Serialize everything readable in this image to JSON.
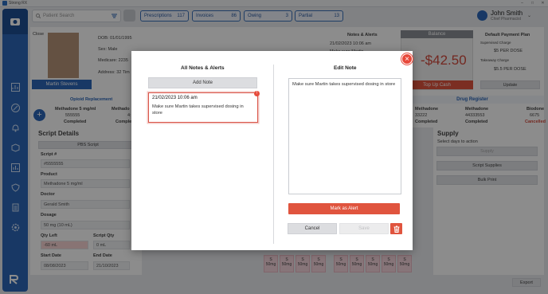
{
  "app": {
    "title": "Strong RX",
    "window_controls": [
      "–",
      "□",
      "✕"
    ]
  },
  "search": {
    "placeholder": "Patient Search"
  },
  "pills": [
    {
      "label": "Prescriptions",
      "count": "117"
    },
    {
      "label": "Invoices",
      "count": "86"
    },
    {
      "label": "Owing",
      "count": "3"
    },
    {
      "label": "Partial",
      "count": "13"
    }
  ],
  "user": {
    "name": "John Smith",
    "role": "Chief Pharmacist"
  },
  "patient": {
    "close_label": "Close",
    "name": "Martin Stevens",
    "dob": "DOB: 01/01/1995",
    "sex": "Sex: Male",
    "medicare": "Medicare: 2235",
    "address": "Address: 32 Tim"
  },
  "notes_panel": {
    "title": "Notes & Alerts",
    "date": "21/02/2023 10:06 am",
    "text": "Make sure Martin"
  },
  "balance": {
    "title": "Balance",
    "amount": "-$42.50",
    "topup": "Top Up Cash"
  },
  "payment": {
    "title": "Default Payment Plan",
    "supervised_label": "Supervised Charge",
    "supervised_value": "$5 PER DOSE",
    "takeaway_label": "Takeaway Charge",
    "takeaway_value": "$5.5 PER DOSE",
    "update": "Update"
  },
  "opioid": {
    "title": "Opioid Replacement",
    "drug1": "Methadone 5 mg/ml",
    "drug1_code": "555555",
    "drug1_status": "Completed",
    "drug2": "Methado",
    "drug2_code": "4:",
    "drug2_status": "Complet"
  },
  "drug_register": {
    "title": "Drug Register",
    "cols": [
      {
        "name": "Methadone",
        "code": "33222",
        "status": "Completed"
      },
      {
        "name": "Methadone",
        "code": "44333553",
        "status": "Completed"
      },
      {
        "name": "Biodone",
        "code": "6675",
        "status": "Cancelled"
      }
    ]
  },
  "script": {
    "title": "Script Details",
    "pbs_btn": "PBS Script",
    "script_no_label": "Script #",
    "script_no": "#5555555",
    "product_label": "Product",
    "product": "Methadone 5 mg/ml",
    "doctor_label": "Doctor",
    "doctor": "Gerald Smith",
    "dosage_label": "Dosage",
    "dosage": "50 mg (10 mL)",
    "qty_left_label": "Qty Left",
    "qty_left": "-60 mL",
    "qty_script_label": "Script Qty",
    "qty_script": "0 mL",
    "start_label": "Start Date",
    "start": "08/08/2023",
    "end_label": "End Date",
    "end": "21/10/2023"
  },
  "supply": {
    "title": "Supply",
    "hint": "Select days to action",
    "btn_supply": "Supply",
    "btn_script_supplies": "Script Supplies",
    "btn_bulk_print": "Bulk Print"
  },
  "slot": {
    "letter": "S",
    "dose": "50mg",
    "type": "Single"
  },
  "export": "Export",
  "modal": {
    "left_title": "All Notes & Alerts",
    "add_note": "Add Note",
    "note": {
      "date": "21/02/2023 10:06 am",
      "text": "Make sure Martin takes supervised dosing in store",
      "badge": "!"
    },
    "right_title": "Edit Note",
    "edit_text": "Make sure Martin takes supervised dosing in store",
    "mark_alert": "Mark as Alert",
    "cancel": "Cancel",
    "save": "Save",
    "close": "×"
  },
  "colors": {
    "brand_blue": "#2c66b8",
    "alert_red": "#e0543e",
    "balance_red": "#d24a3c"
  },
  "icons": [
    "pill-bottle-icon",
    "chart-icon",
    "percent-icon",
    "bell-icon",
    "box-icon",
    "bar-chart-icon",
    "shield-icon",
    "clipboard-icon",
    "gear-icon",
    "filter-icon",
    "user-icon",
    "trash-icon"
  ]
}
